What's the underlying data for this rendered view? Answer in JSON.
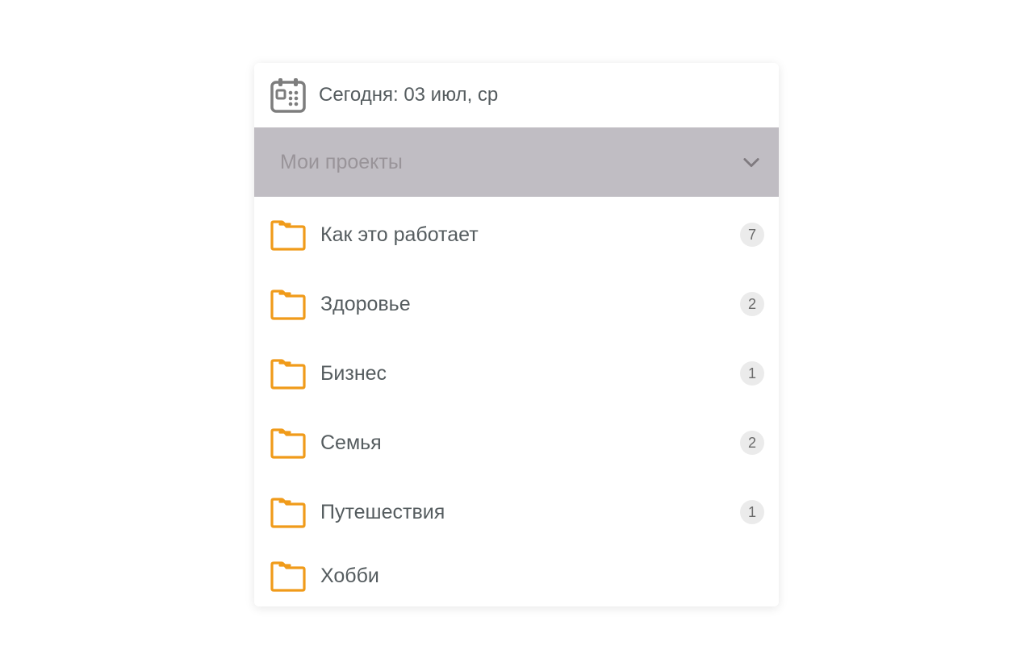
{
  "today": {
    "label": "Сегодня: 03 июл, ср"
  },
  "section": {
    "title": "Мои проекты"
  },
  "colors": {
    "folder": "#f09b1a",
    "sectionBg": "#c0bdc3",
    "text": "#555c5f"
  },
  "projects": [
    {
      "label": "Как это работает",
      "count": "7"
    },
    {
      "label": "Здоровье",
      "count": "2"
    },
    {
      "label": "Бизнес",
      "count": "1"
    },
    {
      "label": "Семья",
      "count": "2"
    },
    {
      "label": "Путешествия",
      "count": "1"
    },
    {
      "label": "Хобби",
      "count": ""
    }
  ]
}
